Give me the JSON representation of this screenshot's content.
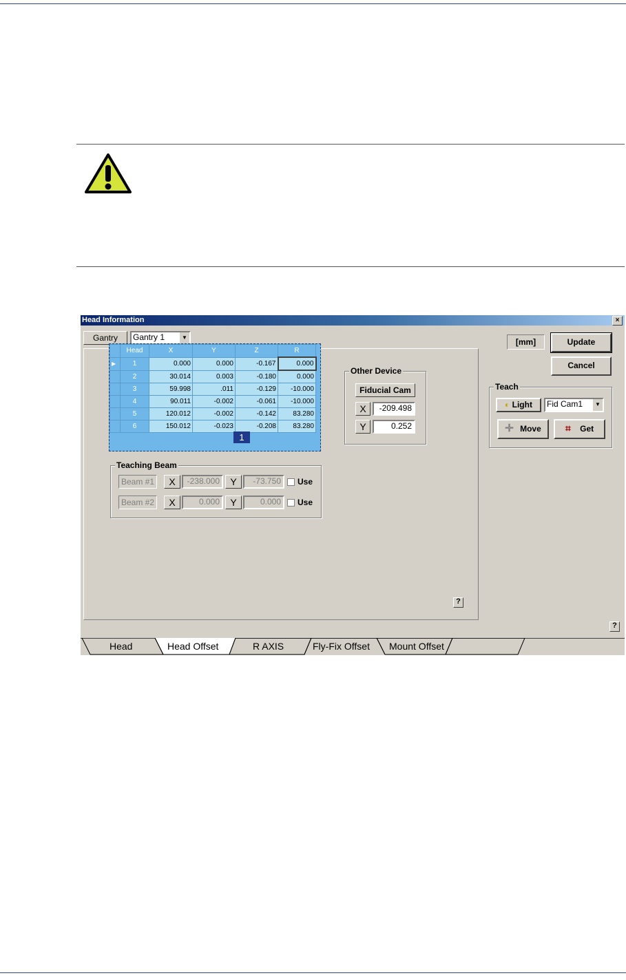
{
  "dialog": {
    "title": "Head Information",
    "close_glyph": "×",
    "gantry_label": "Gantry",
    "gantry_value": "Gantry 1",
    "unit_label": "[mm]",
    "update_label": "Update",
    "cancel_label": "Cancel",
    "help_glyph": "?",
    "callout_number": "1"
  },
  "offset_table": {
    "columns": [
      "Head",
      "X",
      "Y",
      "Z",
      "R"
    ],
    "rows": [
      {
        "head": "1",
        "x": "0.000",
        "y": "0.000",
        "z": "-0.167",
        "r": "0.000"
      },
      {
        "head": "2",
        "x": "30.014",
        "y": "0.003",
        "z": "-0.180",
        "r": "0.000"
      },
      {
        "head": "3",
        "x": "59.998",
        "y": ".011",
        "z": "-0.129",
        "r": "-10.000"
      },
      {
        "head": "4",
        "x": "90.011",
        "y": "-0.002",
        "z": "-0.061",
        "r": "-10.000"
      },
      {
        "head": "5",
        "x": "120.012",
        "y": "-0.002",
        "z": "-0.142",
        "r": "83.280"
      },
      {
        "head": "6",
        "x": "150.012",
        "y": "-0.023",
        "z": "-0.208",
        "r": "83.280"
      }
    ]
  },
  "other_device": {
    "title": "Other Device",
    "device_label": "Fiducial Cam",
    "x_label": "X",
    "x_value": "-209.498",
    "y_label": "Y",
    "y_value": "0.252"
  },
  "teaching_beam": {
    "title": "Teaching Beam",
    "beams": [
      {
        "label": "Beam #1",
        "x_label": "X",
        "x_value": "-238.000",
        "y_label": "Y",
        "y_value": "-73.750",
        "use_label": "Use"
      },
      {
        "label": "Beam #2",
        "x_label": "X",
        "x_value": "0.000",
        "y_label": "Y",
        "y_value": "0.000",
        "use_label": "Use"
      }
    ]
  },
  "teach": {
    "title": "Teach",
    "light_label": "Light",
    "camera_value": "Fid Cam1",
    "move_label": "Move",
    "get_label": "Get"
  },
  "tabs": [
    "Head",
    "Head Offset",
    "R AXIS",
    "Fly-Fix Offset",
    "Mount Offset"
  ],
  "active_tab": "Head Offset",
  "colors": {
    "grid_header": "#6fb7e8",
    "grid_cell": "#b4e0f4",
    "warning_fill": "#d4e43a",
    "callout": "#1f3a8a"
  }
}
